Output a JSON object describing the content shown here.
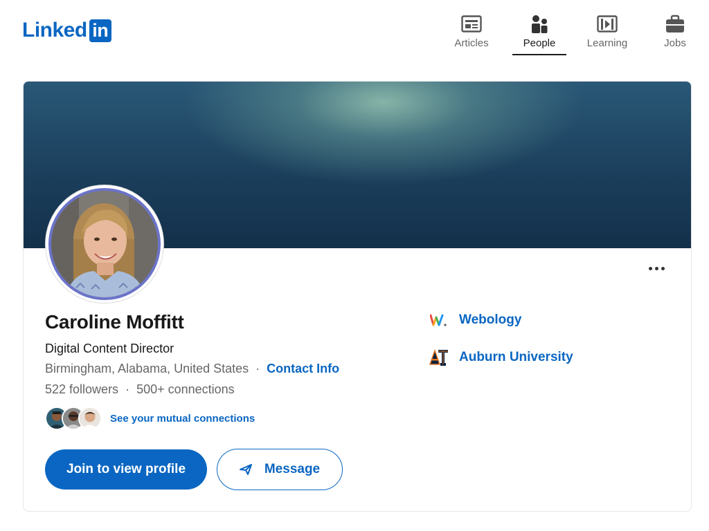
{
  "brand": {
    "logo_text": "Linked",
    "logo_box_text": "in",
    "accent_color": "#0a66c2"
  },
  "nav": {
    "items": [
      {
        "label": "Articles",
        "icon": "articles-icon",
        "active": false
      },
      {
        "label": "People",
        "icon": "people-icon",
        "active": true
      },
      {
        "label": "Learning",
        "icon": "learning-icon",
        "active": false
      },
      {
        "label": "Jobs",
        "icon": "jobs-icon",
        "active": false
      }
    ]
  },
  "profile": {
    "name": "Caroline Moffitt",
    "headline": "Digital Content Director",
    "location": "Birmingham, Alabama, United States",
    "separator": "·",
    "contact_info_label": "Contact Info",
    "followers": "522 followers",
    "connections": "500+ connections",
    "mutual_connections_label": "See your mutual connections",
    "more_icon": "more-horizontal-icon"
  },
  "actions": {
    "join_label": "Join to view profile",
    "message_label": "Message",
    "message_icon": "send-icon"
  },
  "experience": [
    {
      "name": "Webology",
      "logo_icon": "webology-logo-icon"
    },
    {
      "name": "Auburn University",
      "logo_icon": "auburn-logo-icon"
    }
  ]
}
